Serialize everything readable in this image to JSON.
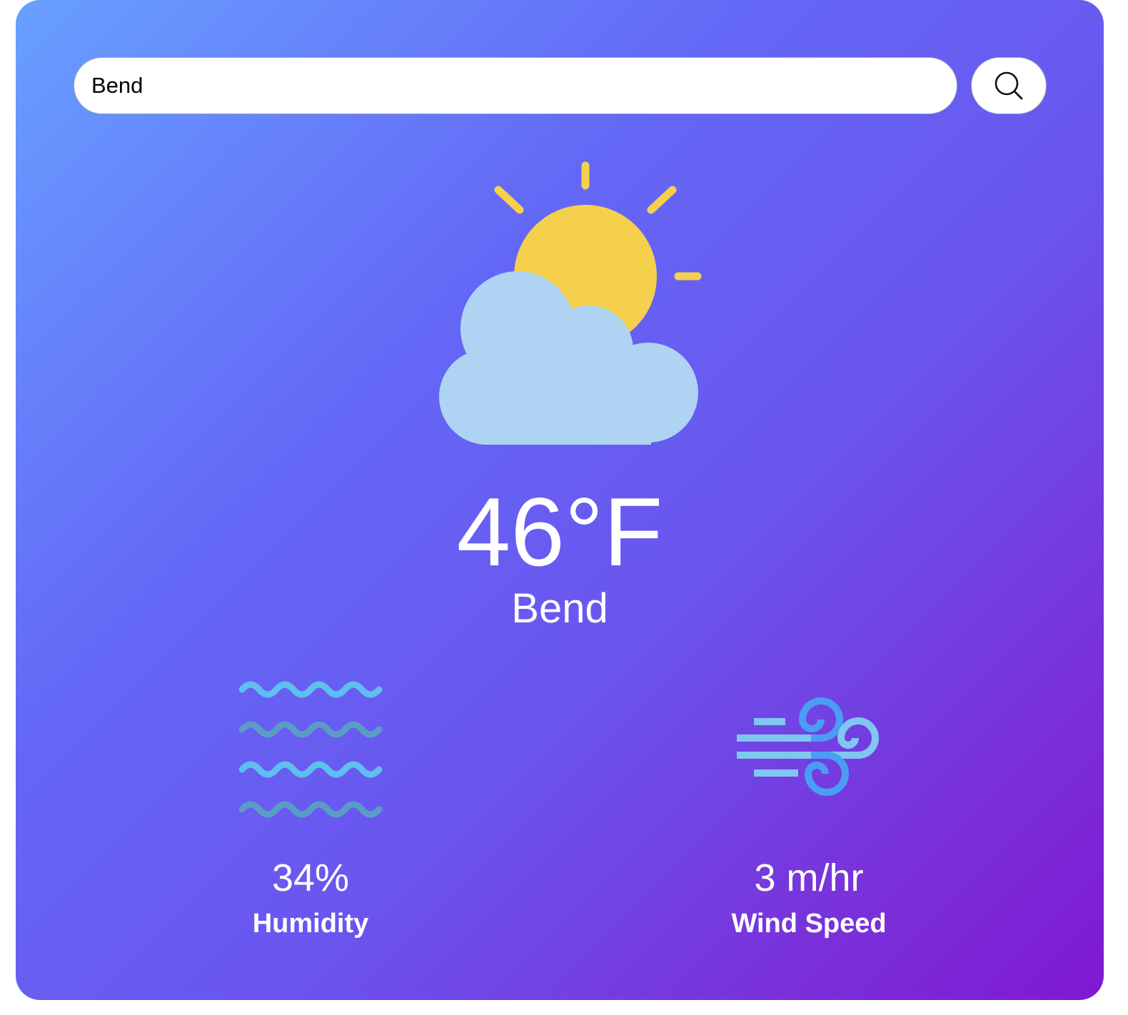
{
  "search": {
    "value": "Bend",
    "button_icon": "search-icon"
  },
  "weather": {
    "condition_icon": "partly-cloudy-icon",
    "temperature": "46°F",
    "city": "Bend"
  },
  "stats": {
    "humidity": {
      "icon": "humidity-waves-icon",
      "value": "34%",
      "label": "Humidity"
    },
    "wind": {
      "icon": "wind-icon",
      "value": "3 m/hr",
      "label": "Wind Speed"
    }
  },
  "colors": {
    "gradient_start": "#68a0ff",
    "gradient_mid": "#6468f6",
    "gradient_end": "#7f18d2",
    "sun": "#f5d04d",
    "cloud": "#aed3f3",
    "wave_light": "#5fbfee",
    "wave_dark": "#5a9cc6",
    "wind_light": "#7fc7f0",
    "wind_blue": "#4a9df3"
  }
}
